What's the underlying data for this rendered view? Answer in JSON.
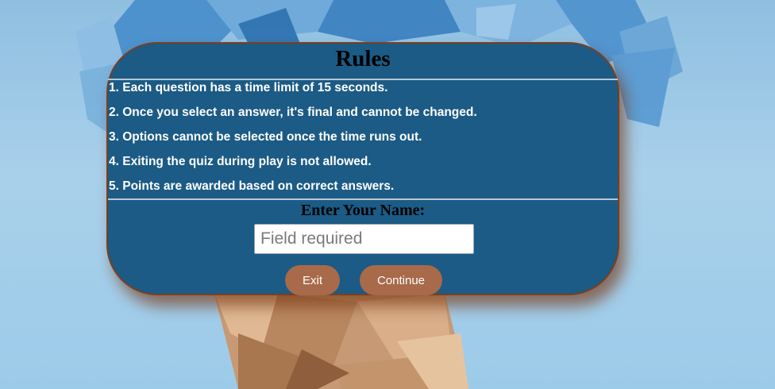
{
  "rules": {
    "title": "Rules",
    "items": [
      "1. Each question has a time limit of 15 seconds.",
      "2. Once you select an answer, it's final and cannot be changed.",
      "3. Options cannot be selected once the time runs out.",
      "4. Exiting the quiz during play is not allowed.",
      "5. Points are awarded based on correct answers."
    ]
  },
  "name_form": {
    "label": "Enter Your Name:",
    "value": "",
    "placeholder": "Field required"
  },
  "buttons": {
    "exit": "Exit",
    "continue": "Continue"
  },
  "colors": {
    "card": "#1b5b85",
    "button": "#a86a4a",
    "background": "#a9d0eb"
  }
}
